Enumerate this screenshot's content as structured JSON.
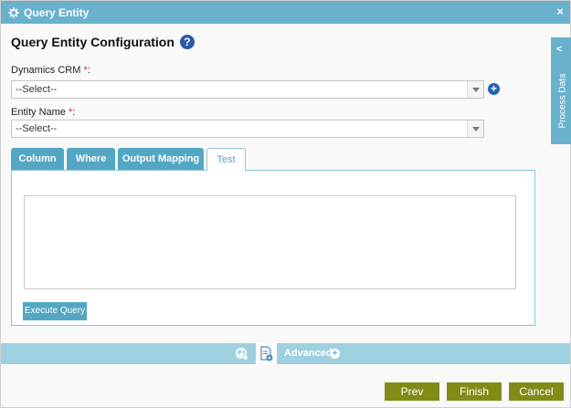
{
  "window": {
    "title": "Query Entity"
  },
  "heading": "Query Entity Configuration",
  "fields": {
    "crm": {
      "label": "Dynamics CRM ",
      "required": "*",
      "suffix": ":",
      "value": "--Select--"
    },
    "entity": {
      "label": "Entity Name ",
      "required": "*",
      "suffix": ":",
      "value": "--Select--"
    }
  },
  "tabs": [
    {
      "label": "Column"
    },
    {
      "label": "Where"
    },
    {
      "label": "Output Mapping"
    },
    {
      "label": "Test"
    }
  ],
  "test_panel": {
    "execute_label": "Execute Query"
  },
  "side_panel": {
    "label": "Process Data"
  },
  "bottom_bar": {
    "advanced_label": "Advanced"
  },
  "footer": {
    "prev": "Prev",
    "finish": "Finish",
    "cancel": "Cancel"
  },
  "colors": {
    "accent": "#6ab1cd",
    "tab": "#53a7c4",
    "action_button": "#818c17",
    "required": "#d9312b"
  }
}
